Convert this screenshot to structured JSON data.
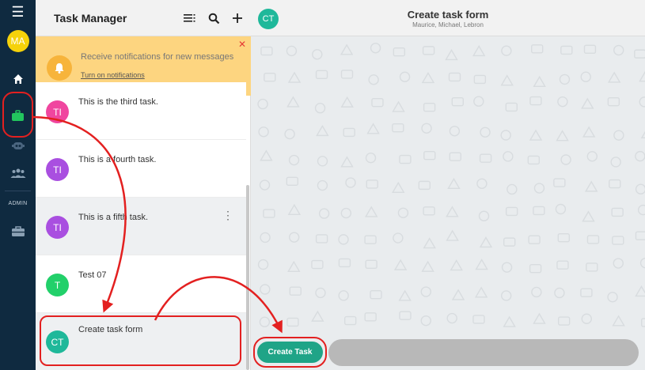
{
  "app": {
    "title": "Task Manager"
  },
  "rail": {
    "avatar_initials": "MA",
    "admin_label": "ADMIN"
  },
  "notification": {
    "message": "Receive notifications for new messages",
    "link": "Turn on notifications",
    "close": "✕"
  },
  "tasks": [
    {
      "initials": "TI",
      "title": "This is the third task.",
      "color": "#f0469f"
    },
    {
      "initials": "TI",
      "title": "This is a fourth task.",
      "color": "#a94fe0"
    },
    {
      "initials": "TI",
      "title": "This is a fifth task.",
      "color": "#a94fe0"
    },
    {
      "initials": "T",
      "title": "Test 07",
      "color": "#22d06a"
    },
    {
      "initials": "CT",
      "title": "Create task form",
      "color": "#1fb89a"
    }
  ],
  "chat": {
    "avatar_initials": "CT",
    "title": "Create task form",
    "subtitle": "Maurice, Michael, Lebron",
    "create_button": "Create Task"
  },
  "colors": {
    "rail_bg": "#0f2a40",
    "accent": "#1fa487",
    "annotation": "#e32020"
  }
}
